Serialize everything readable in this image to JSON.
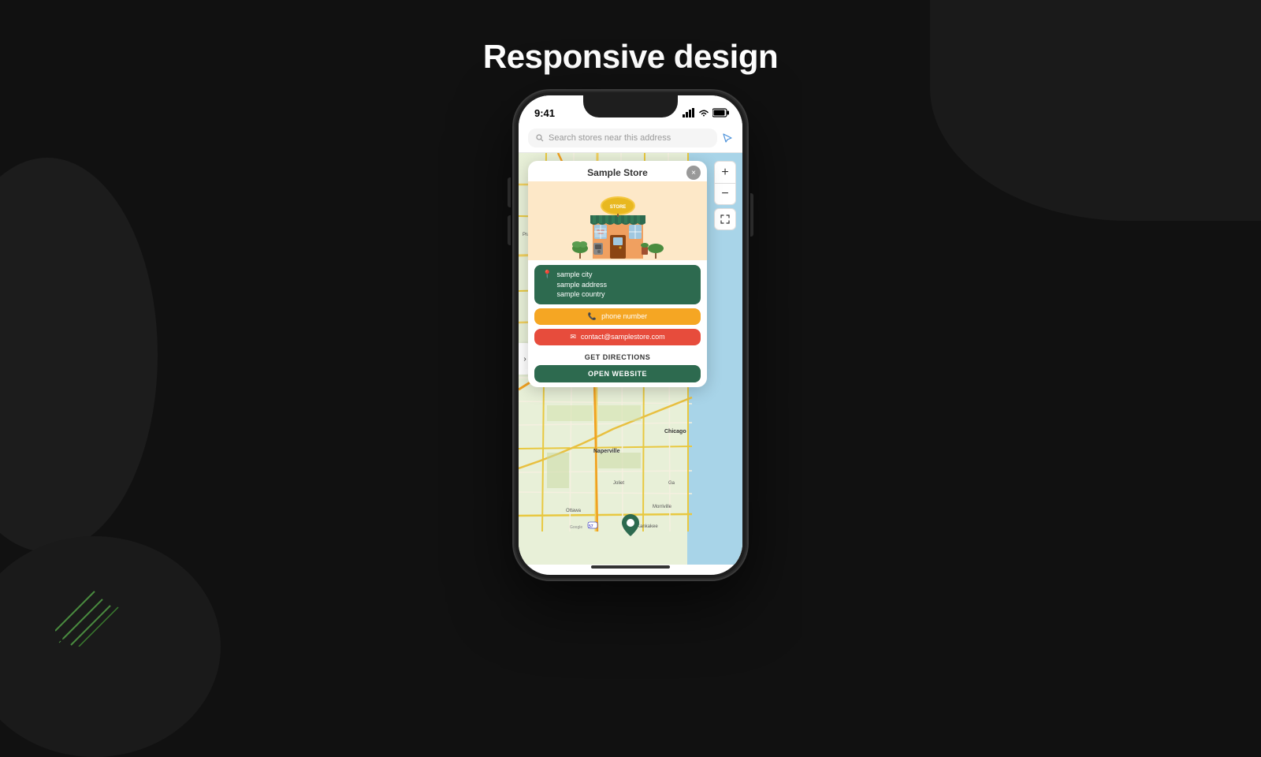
{
  "page": {
    "title": "Responsive design",
    "background_color": "#111111"
  },
  "phone": {
    "status_bar": {
      "time": "9:41",
      "signal": "signal-icon",
      "wifi": "wifi-icon",
      "battery": "battery-icon"
    },
    "search": {
      "placeholder": "Search stores near this address"
    },
    "map": {
      "plus_label": "+",
      "minus_label": "−",
      "fullscreen_label": "⛶"
    },
    "popup": {
      "title": "Sample Store",
      "close": "×",
      "address": {
        "city": "sample city",
        "street": "sample address",
        "country": "sample country"
      },
      "phone_number": "phone number",
      "email": "contact@samplestore.com",
      "directions_label": "GET DIRECTIONS",
      "website_label": "OPEN WEBSITE"
    },
    "sidebar_arrow": "›"
  },
  "decorative": {
    "green_lines_count": 4
  }
}
